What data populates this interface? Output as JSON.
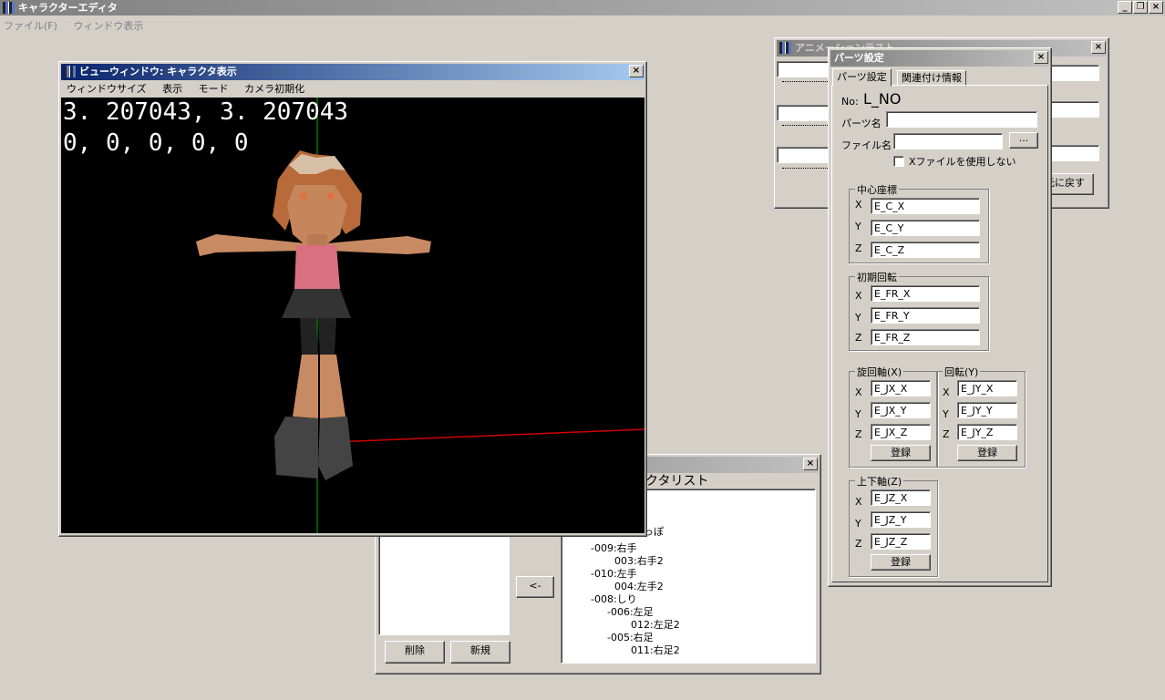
{
  "app": {
    "title": "キャラクターエディタ",
    "menu": [
      "ファイル(F)",
      "ウィンドウ表示"
    ]
  },
  "view_window": {
    "title": "ビューウィンドウ: キャラクタ表示",
    "menu": [
      "ウィンドウサイズ",
      "表示",
      "モード",
      "カメラ初期化"
    ],
    "overlay_line1": "3. 207043, 3. 207043",
    "overlay_line2": "0, 0, 0, 0, 0"
  },
  "anim_window": {
    "title": "アニメーションテスト",
    "return_button": "元に戻す"
  },
  "char_list_window": {
    "title": "キャラクタリスト",
    "move_button": "<-",
    "delete_button": "削除",
    "new_button": "新規",
    "tree": [
      "-009:右手",
      "003:右手2",
      "-010:左手",
      "004:左手2",
      "-008:しり",
      "-006:左足",
      "012:左足2",
      "-005:右足",
      "011:右足2"
    ],
    "partial_text": "っぽ"
  },
  "parts_window": {
    "title": "パーツ設定",
    "tabs": [
      "パーツ設定",
      "関連付け情報"
    ],
    "no_label": "No:",
    "no_value": "L_NO",
    "name_label": "パーツ名",
    "file_label": "ファイル名",
    "browse_button": "...",
    "checkbox_label": "Xファイルを使用しない",
    "center": {
      "title": "中心座標",
      "x": "E_C_X",
      "y": "E_C_Y",
      "z": "E_C_Z"
    },
    "rotation": {
      "title": "初期回転",
      "x": "E_FR_X",
      "y": "E_FR_Y",
      "z": "E_FR_Z"
    },
    "jx": {
      "title": "旋回軸(X)",
      "x": "E_JX_X",
      "y": "E_JX_Y",
      "z": "E_JX_Z",
      "button": "登録"
    },
    "jy": {
      "title": "回転(Y)",
      "x": "E_JY_X",
      "y": "E_JY_Y",
      "z": "E_JY_Z",
      "button": "登録"
    },
    "jz": {
      "title": "上下軸(Z)",
      "x": "E_JZ_X",
      "y": "E_JZ_Y",
      "z": "E_JZ_Z",
      "button": "登録"
    },
    "axis_labels": {
      "x": "X",
      "y": "Y",
      "z": "Z"
    }
  },
  "colors": {
    "active_title": "#0a246a",
    "inactive_title": "#808080",
    "face": "#d4d0c8",
    "viewport": "#000000"
  }
}
